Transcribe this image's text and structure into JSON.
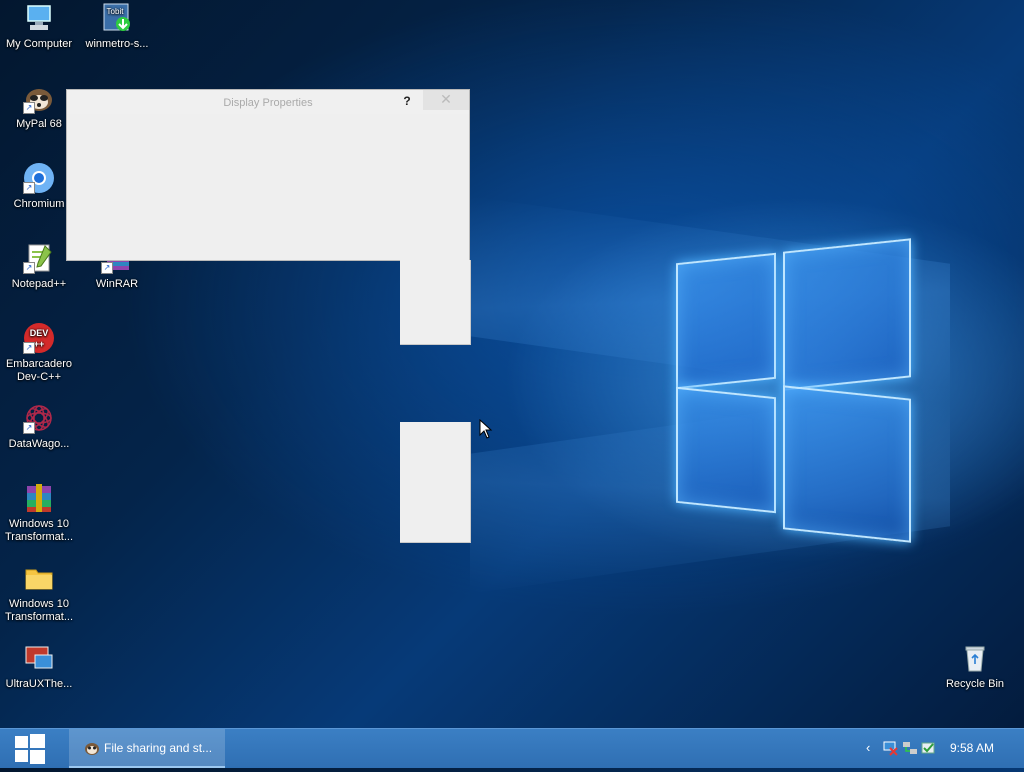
{
  "desktop": {
    "icons_col1": [
      {
        "label": "My Computer",
        "icon": "computer-icon"
      },
      {
        "label": "MyPal 68",
        "icon": "mypal-browser-icon"
      },
      {
        "label": "Chromium",
        "icon": "chromium-icon"
      },
      {
        "label": "Notepad++",
        "icon": "notepadpp-icon"
      },
      {
        "label": "Embarcadero Dev-C++",
        "icon": "devcpp-icon"
      },
      {
        "label": "DataWago...",
        "icon": "datawagon-icon"
      },
      {
        "label": "Windows 10 Transformat...",
        "icon": "winrar-archive-icon"
      },
      {
        "label": "Windows 10 Transformat...",
        "icon": "folder-icon"
      },
      {
        "label": "UltraUXThe...",
        "icon": "ultrauxtheme-icon"
      }
    ],
    "icons_col2": [
      {
        "label": "winmetro-s...",
        "icon": "tobit-installer-icon"
      },
      {
        "label": "WinRAR",
        "icon": "winrar-icon"
      }
    ],
    "recycle_bin": {
      "label": "Recycle Bin",
      "icon": "recycle-bin-icon"
    }
  },
  "dialog": {
    "title": "Display Properties",
    "help_label": "?",
    "close_label": "✕"
  },
  "taskbar": {
    "start_icon": "windows-logo-icon",
    "task_button": {
      "label": "File sharing and st...",
      "icon": "mypal-browser-icon"
    },
    "tray": {
      "chevron": "‹",
      "icons": [
        "network-disconnected-icon",
        "network-icon",
        "security-icon"
      ]
    },
    "clock": "9:58 AM"
  },
  "colors": {
    "taskbar": "#2f6fb3",
    "wallpaper_dark": "#03172f",
    "wallpaper_light": "#4fb3ff"
  }
}
